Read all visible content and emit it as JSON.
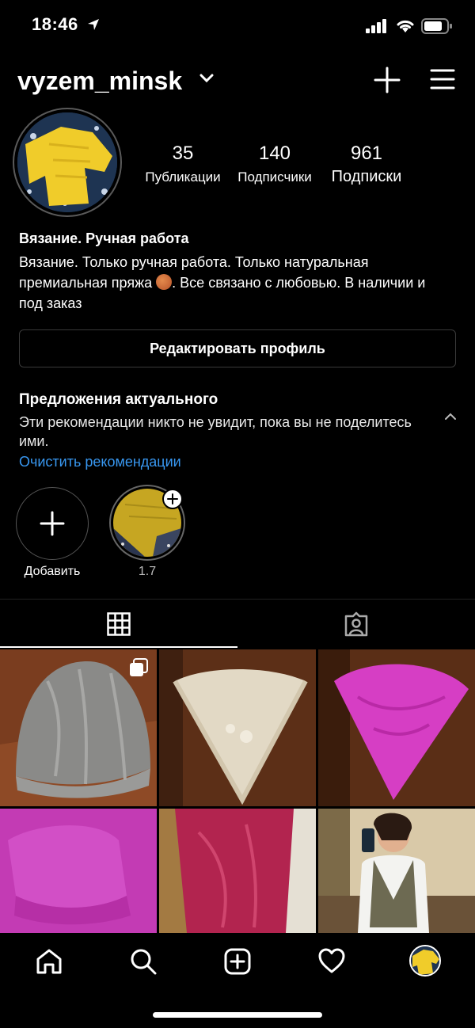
{
  "status": {
    "time": "18:46"
  },
  "header": {
    "username": "vyzem_minsk"
  },
  "stats": [
    {
      "value": "35",
      "label": "Публикации"
    },
    {
      "value": "140",
      "label": "Подписчики"
    },
    {
      "value": "961",
      "label": "Подписки"
    }
  ],
  "bio": {
    "name": "Вязание. Ручная работа",
    "text_before": "Вязание. Только ручная работа. Только натуральная премиальная пряжа",
    "text_after": ". Все связано с любовью. В наличии и под заказ"
  },
  "edit_profile_label": "Редактировать профиль",
  "suggestions": {
    "title": "Предложения актуального",
    "text": "Эти рекомендации никто не увидит, пока вы не поделитесь ими.",
    "clear_link": "Очистить рекомендации"
  },
  "highlights": [
    {
      "label": "Добавить"
    },
    {
      "label": "1.7"
    }
  ],
  "colors": {
    "link": "#3897f0",
    "background": "#000000"
  }
}
